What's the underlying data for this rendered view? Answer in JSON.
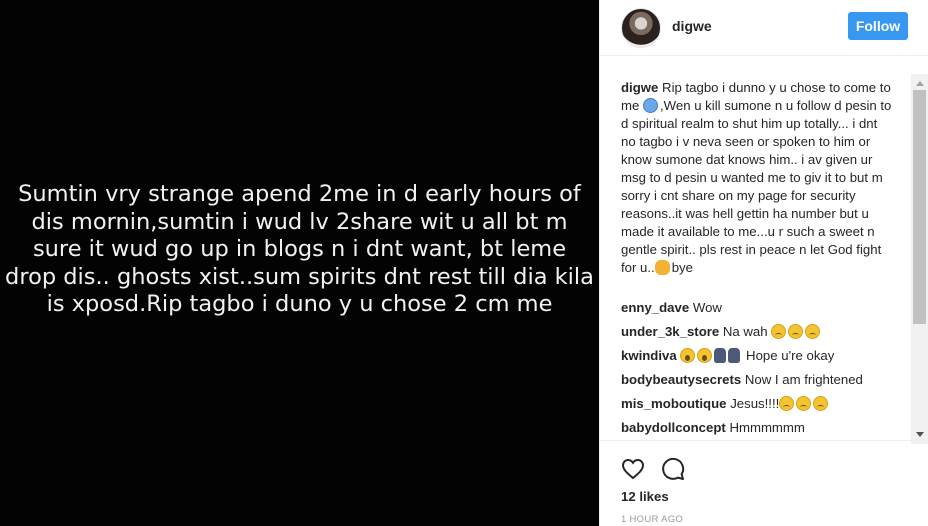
{
  "post": {
    "image_text": "Sumtin vry strange apend 2me in d early hours of dis mornin,sumtin i wud lv 2share wit u all bt m sure it wud go up in blogs n i dnt want, bt leme drop dis.. ghosts xist..sum spirits dnt rest till dia kila is xposd.Rip tagbo i duno y u chose 2 cm me"
  },
  "header": {
    "username": "digwe",
    "follow_label": "Follow"
  },
  "caption": {
    "username": "digwe",
    "text_part1": "Rip tagbo i dunno y u chose to come to me ",
    "text_part2": ",Wen u kill sumone n u follow d pesin to d spiritual realm to shut him up totally... i dnt no tagbo i v neva seen or spoken to him or know sumone dat knows him.. i av given ur msg to d pesin u wanted me to giv it to but m sorry i cnt share on my page for security reasons..it was hell gettin ha number but u made it available to me...u r such a sweet n gentle spirit.. pls rest in peace n let God fight for u..",
    "text_part3": "bye"
  },
  "comments": [
    {
      "username": "enny_dave",
      "text": "Wow"
    },
    {
      "username": "under_3k_store",
      "text": "Na wah"
    },
    {
      "username": "kwindiva",
      "text": "Hope u're okay"
    },
    {
      "username": "bodybeautysecrets",
      "text": "Now I am frightened"
    },
    {
      "username": "mis_moboutique",
      "text": "Jesus!!!!"
    },
    {
      "username": "babydollconcept",
      "text": "Hmmmmmm"
    }
  ],
  "actions": {
    "likes": "12 likes",
    "timestamp": "1 HOUR AGO"
  },
  "colors": {
    "accent": "#3897f0",
    "text": "#262626",
    "muted": "#999999",
    "image_bg": "#030303"
  }
}
